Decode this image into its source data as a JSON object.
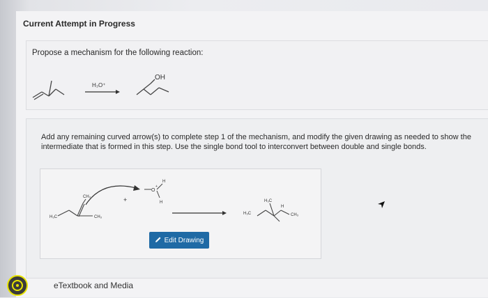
{
  "header": {
    "title": "Current Attempt in Progress"
  },
  "question": {
    "prompt": "Propose a mechanism for the following reaction:",
    "reagent": "H₃O⁺",
    "product_group": "OH"
  },
  "step": {
    "instructions": "Add any remaining curved arrow(s) to complete step 1 of the mechanism, and modify the given drawing as needed to show the intermediate that is formed in this step. Use the single bond tool to interconvert between double and single bonds.",
    "labels": {
      "h3c_left": "H₃C",
      "ch3_top": "CH₃",
      "ch3_right": "CH₃",
      "plus": "+",
      "o_atom": "O",
      "o_charge": "+",
      "h_top": "H",
      "h_bottom": "H",
      "h3c_product_top": "H₃C",
      "h_product": "H",
      "h3c_product_left": "H₃C",
      "ch3_product_right": "CH₃"
    },
    "edit_button": "Edit Drawing"
  },
  "footer": {
    "link": "eTextbook and Media"
  },
  "icons": {
    "pencil": "pencil-icon",
    "cursor": "cursor-icon",
    "badge": "help-badge-icon"
  }
}
